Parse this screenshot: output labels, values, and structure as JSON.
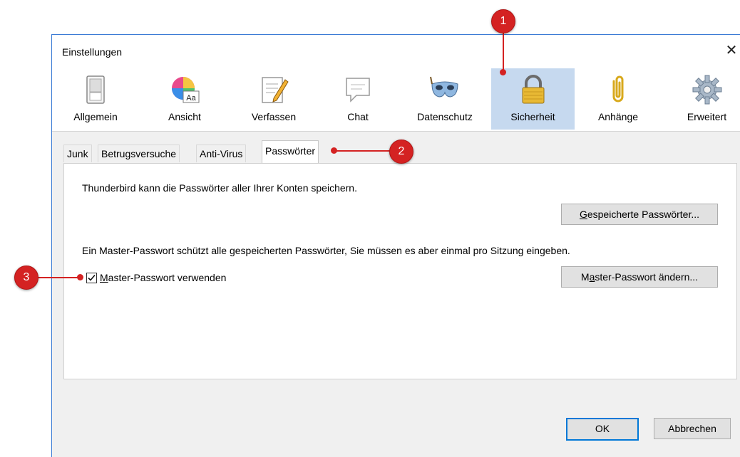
{
  "window": {
    "title": "Einstellungen",
    "close_glyph": "✕"
  },
  "toolbar": {
    "items": [
      {
        "label": "Allgemein",
        "icon": "switch-icon"
      },
      {
        "label": "Ansicht",
        "icon": "color-wheel-icon"
      },
      {
        "label": "Verfassen",
        "icon": "notepad-pencil-icon"
      },
      {
        "label": "Chat",
        "icon": "chat-bubble-icon"
      },
      {
        "label": "Datenschutz",
        "icon": "mask-icon"
      },
      {
        "label": "Sicherheit",
        "icon": "padlock-icon",
        "selected": true
      },
      {
        "label": "Anhänge",
        "icon": "paperclip-icon"
      },
      {
        "label": "Erweitert",
        "icon": "gear-icon"
      }
    ]
  },
  "tabs": [
    {
      "label": "Junk"
    },
    {
      "label": "Betrugsversuche"
    },
    {
      "label": "Anti-Virus"
    },
    {
      "label": "Passwörter",
      "selected": true
    }
  ],
  "passwords": {
    "intro": "Thunderbird kann die Passwörter aller Ihrer Konten speichern.",
    "saved_button_u": "G",
    "saved_button_rest": "espeicherte Passwörter...",
    "master_desc": "Ein Master-Passwort schützt alle gespeicherten Passwörter, Sie müssen es aber einmal pro Sitzung eingeben.",
    "master_checkbox_u": "M",
    "master_checkbox_rest": "aster-Passwort verwenden",
    "master_checked": true,
    "change_button_pre": "M",
    "change_button_u": "a",
    "change_button_rest": "ster-Passwort ändern..."
  },
  "footer": {
    "ok": "OK",
    "cancel": "Abbrechen"
  },
  "markers": {
    "one": "1",
    "two": "2",
    "three": "3"
  },
  "colors": {
    "accent": "#0078d7",
    "marker": "#d42222",
    "selected_bg": "#c6d9ef"
  }
}
